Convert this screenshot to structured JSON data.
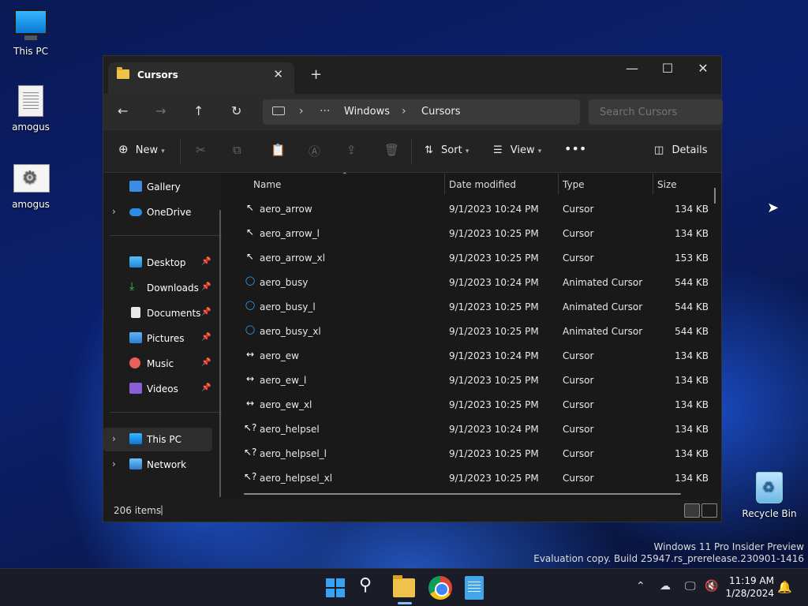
{
  "desktop": {
    "icons": [
      {
        "label": "This PC"
      },
      {
        "label": "amogus"
      },
      {
        "label": "amogus"
      },
      {
        "label": "Recycle Bin"
      }
    ],
    "watermark": {
      "line1": "Windows 11 Pro Insider Preview",
      "line2": "Evaluation copy. Build 25947.rs_prerelease.230901-1416"
    }
  },
  "explorer": {
    "tab_title": "Cursors",
    "breadcrumb": [
      "Windows",
      "Cursors"
    ],
    "search_placeholder": "Search Cursors",
    "toolbar": {
      "new_label": "New",
      "sort_label": "Sort",
      "view_label": "View",
      "details_label": "Details"
    },
    "sidebar": {
      "gallery": "Gallery",
      "onedrive": "OneDrive",
      "desktop": "Desktop",
      "downloads": "Downloads",
      "documents": "Documents",
      "pictures": "Pictures",
      "music": "Music",
      "videos": "Videos",
      "this_pc": "This PC",
      "network": "Network"
    },
    "columns": {
      "name": "Name",
      "date": "Date modified",
      "type": "Type",
      "size": "Size"
    },
    "files": [
      {
        "name": "aero_arrow",
        "date": "9/1/2023 10:24 PM",
        "type": "Cursor",
        "size": "134 KB"
      },
      {
        "name": "aero_arrow_l",
        "date": "9/1/2023 10:25 PM",
        "type": "Cursor",
        "size": "134 KB"
      },
      {
        "name": "aero_arrow_xl",
        "date": "9/1/2023 10:25 PM",
        "type": "Cursor",
        "size": "153 KB"
      },
      {
        "name": "aero_busy",
        "date": "9/1/2023 10:24 PM",
        "type": "Animated Cursor",
        "size": "544 KB"
      },
      {
        "name": "aero_busy_l",
        "date": "9/1/2023 10:25 PM",
        "type": "Animated Cursor",
        "size": "544 KB"
      },
      {
        "name": "aero_busy_xl",
        "date": "9/1/2023 10:25 PM",
        "type": "Animated Cursor",
        "size": "544 KB"
      },
      {
        "name": "aero_ew",
        "date": "9/1/2023 10:24 PM",
        "type": "Cursor",
        "size": "134 KB"
      },
      {
        "name": "aero_ew_l",
        "date": "9/1/2023 10:25 PM",
        "type": "Cursor",
        "size": "134 KB"
      },
      {
        "name": "aero_ew_xl",
        "date": "9/1/2023 10:25 PM",
        "type": "Cursor",
        "size": "134 KB"
      },
      {
        "name": "aero_helpsel",
        "date": "9/1/2023 10:24 PM",
        "type": "Cursor",
        "size": "134 KB"
      },
      {
        "name": "aero_helpsel_l",
        "date": "9/1/2023 10:25 PM",
        "type": "Cursor",
        "size": "134 KB"
      },
      {
        "name": "aero_helpsel_xl",
        "date": "9/1/2023 10:25 PM",
        "type": "Cursor",
        "size": "134 KB"
      }
    ],
    "status": {
      "item_count": "206 items"
    }
  },
  "taskbar": {
    "time": "11:19 AM",
    "date": "1/28/2024"
  }
}
